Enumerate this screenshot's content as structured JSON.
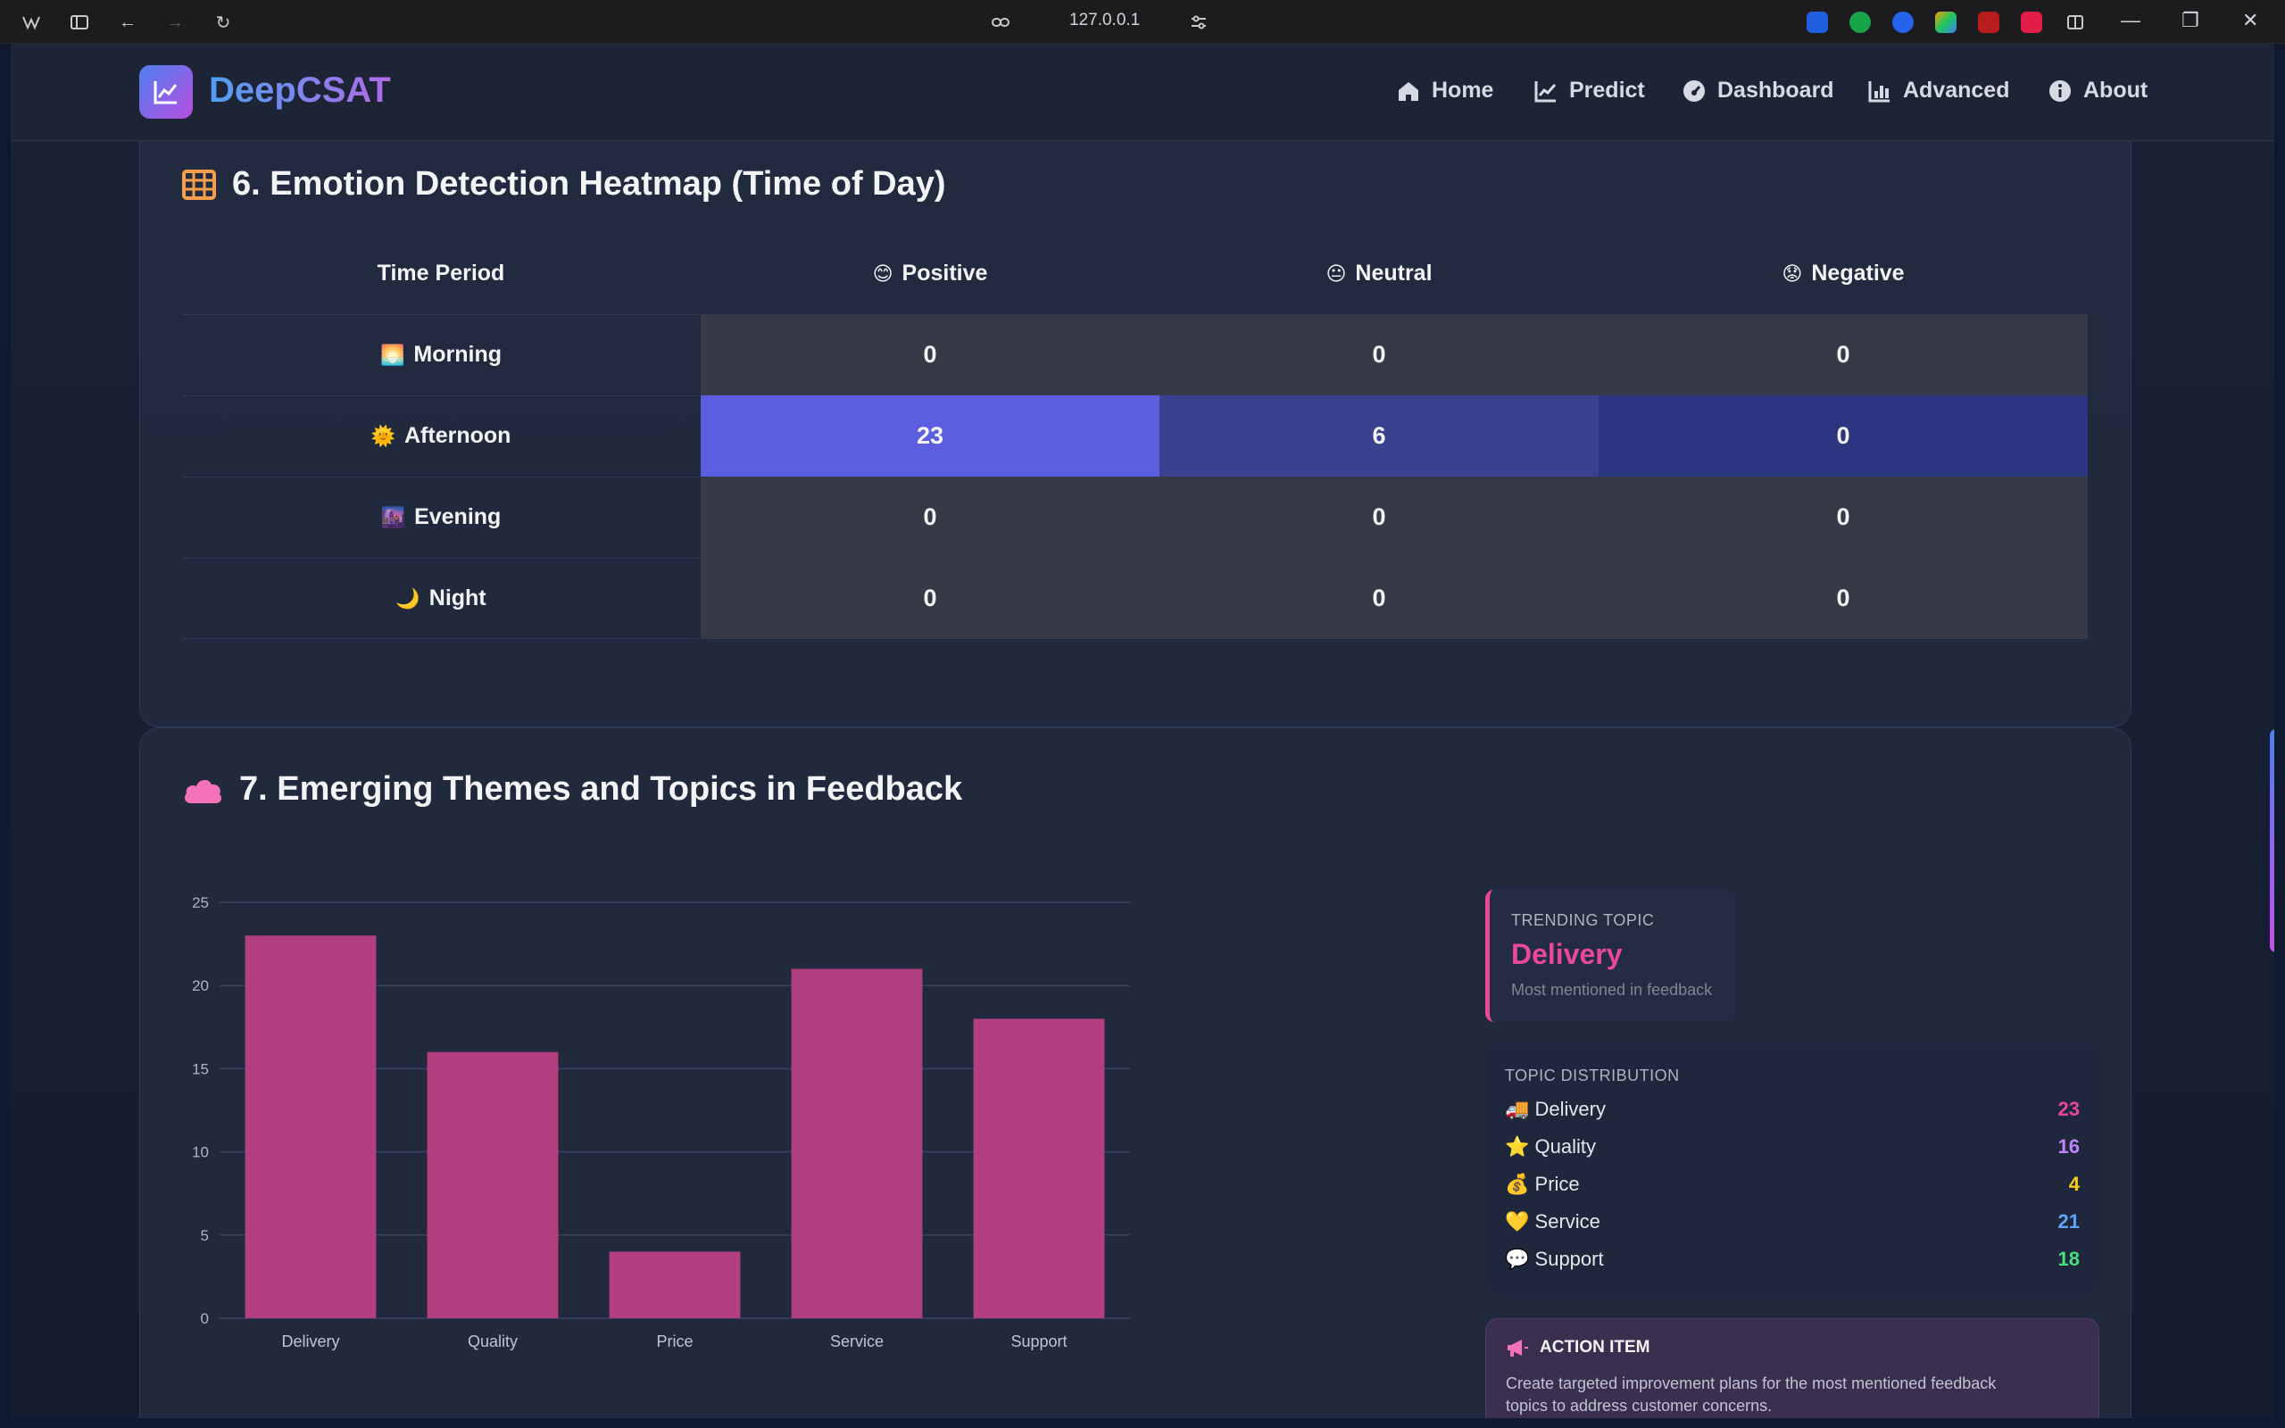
{
  "browser": {
    "url": "127.0.0.1"
  },
  "app": {
    "brand": "DeepCSAT",
    "nav": [
      {
        "label": "Home",
        "icon": "home-icon"
      },
      {
        "label": "Predict",
        "icon": "line-chart-icon"
      },
      {
        "label": "Dashboard",
        "icon": "gauge-icon"
      },
      {
        "label": "Advanced",
        "icon": "bar-chart-icon"
      },
      {
        "label": "About",
        "icon": "info-icon"
      }
    ]
  },
  "heatmap": {
    "title": "6. Emotion Detection Heatmap (Time of Day)",
    "columns": [
      "Time Period",
      "Positive",
      "Neutral",
      "Negative"
    ],
    "column_emojis": [
      "",
      "😊",
      "😐",
      "😟"
    ],
    "rows": [
      {
        "label": "Morning",
        "emoji": "🌅",
        "values": [
          "0",
          "0",
          "0"
        ]
      },
      {
        "label": "Afternoon",
        "emoji": "🌞",
        "values": [
          "23",
          "6",
          "0"
        ]
      },
      {
        "label": "Evening",
        "emoji": "🌆",
        "values": [
          "0",
          "0",
          "0"
        ]
      },
      {
        "label": "Night",
        "emoji": "🌙",
        "values": [
          "0",
          "0",
          "0"
        ]
      }
    ],
    "colors": {
      "empty": "#353a46",
      "high": "#5b5ee0",
      "mid": "#3a4190",
      "low": "#2c3580"
    }
  },
  "themes": {
    "title": "7. Emerging Themes and Topics in Feedback",
    "trending": {
      "kicker": "TRENDING TOPIC",
      "topic": "Delivery",
      "sub": "Most mentioned in feedback"
    },
    "distribution": {
      "heading": "TOPIC DISTRIBUTION",
      "items": [
        {
          "emoji": "🚚",
          "label": "Delivery",
          "value": "23",
          "color": "#ec4899"
        },
        {
          "emoji": "⭐",
          "label": "Quality",
          "value": "16",
          "color": "#c084fc"
        },
        {
          "emoji": "💰",
          "label": "Price",
          "value": "4",
          "color": "#facc15"
        },
        {
          "emoji": "💛",
          "label": "Service",
          "value": "21",
          "color": "#60a5fa"
        },
        {
          "emoji": "💬",
          "label": "Support",
          "value": "18",
          "color": "#4ade80"
        }
      ]
    },
    "action": {
      "heading": "ACTION ITEM",
      "text_line1": "Create targeted improvement plans for the most mentioned feedback",
      "text_line2": "topics to address customer concerns."
    }
  },
  "chart_data": {
    "type": "bar",
    "categories": [
      "Delivery",
      "Quality",
      "Price",
      "Service",
      "Support"
    ],
    "values": [
      23,
      16,
      4,
      21,
      18
    ],
    "ylim": [
      0,
      25
    ],
    "yticks": [
      0,
      5,
      10,
      15,
      20,
      25
    ],
    "bar_color": "#b3407e",
    "grid": true
  }
}
